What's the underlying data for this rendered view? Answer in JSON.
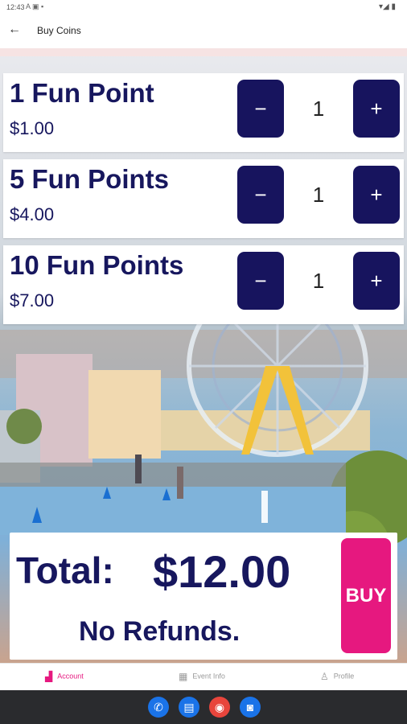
{
  "status_bar": {
    "time": "12:43",
    "left_icons": "A ▣ ▪",
    "right_icons": "▾◢ ▮"
  },
  "app_bar": {
    "back_icon": "←",
    "title": "Buy Coins"
  },
  "products": [
    {
      "name": "1 Fun Point",
      "price": "$1.00",
      "quantity": "1",
      "minus": "−",
      "plus": "+"
    },
    {
      "name": "5 Fun Points",
      "price": "$4.00",
      "quantity": "1",
      "minus": "−",
      "plus": "+"
    },
    {
      "name": "10 Fun Points",
      "price": "$7.00",
      "quantity": "1",
      "minus": "−",
      "plus": "+"
    }
  ],
  "total": {
    "label": "Total:",
    "value": "$12.00",
    "note": "No Refunds.",
    "buy_label": "BUY"
  },
  "bottom_nav": [
    {
      "label": "Account",
      "icon": "account-icon",
      "glyph": "▟",
      "active": true
    },
    {
      "label": "Event Info",
      "icon": "calendar-icon",
      "glyph": "▦",
      "active": false
    },
    {
      "label": "Profile",
      "icon": "person-icon",
      "glyph": "♙",
      "active": false
    }
  ],
  "dock": [
    {
      "icon": "phone-icon",
      "glyph": "✆",
      "color": "#1a73e8"
    },
    {
      "icon": "messages-icon",
      "glyph": "▤",
      "color": "#1a73e8"
    },
    {
      "icon": "chrome-icon",
      "glyph": "◉",
      "color": "#e8453c"
    },
    {
      "icon": "camera-icon",
      "glyph": "◙",
      "color": "#1a73e8"
    }
  ],
  "colors": {
    "brand_navy": "#17145e",
    "accent_pink": "#e6187f"
  }
}
